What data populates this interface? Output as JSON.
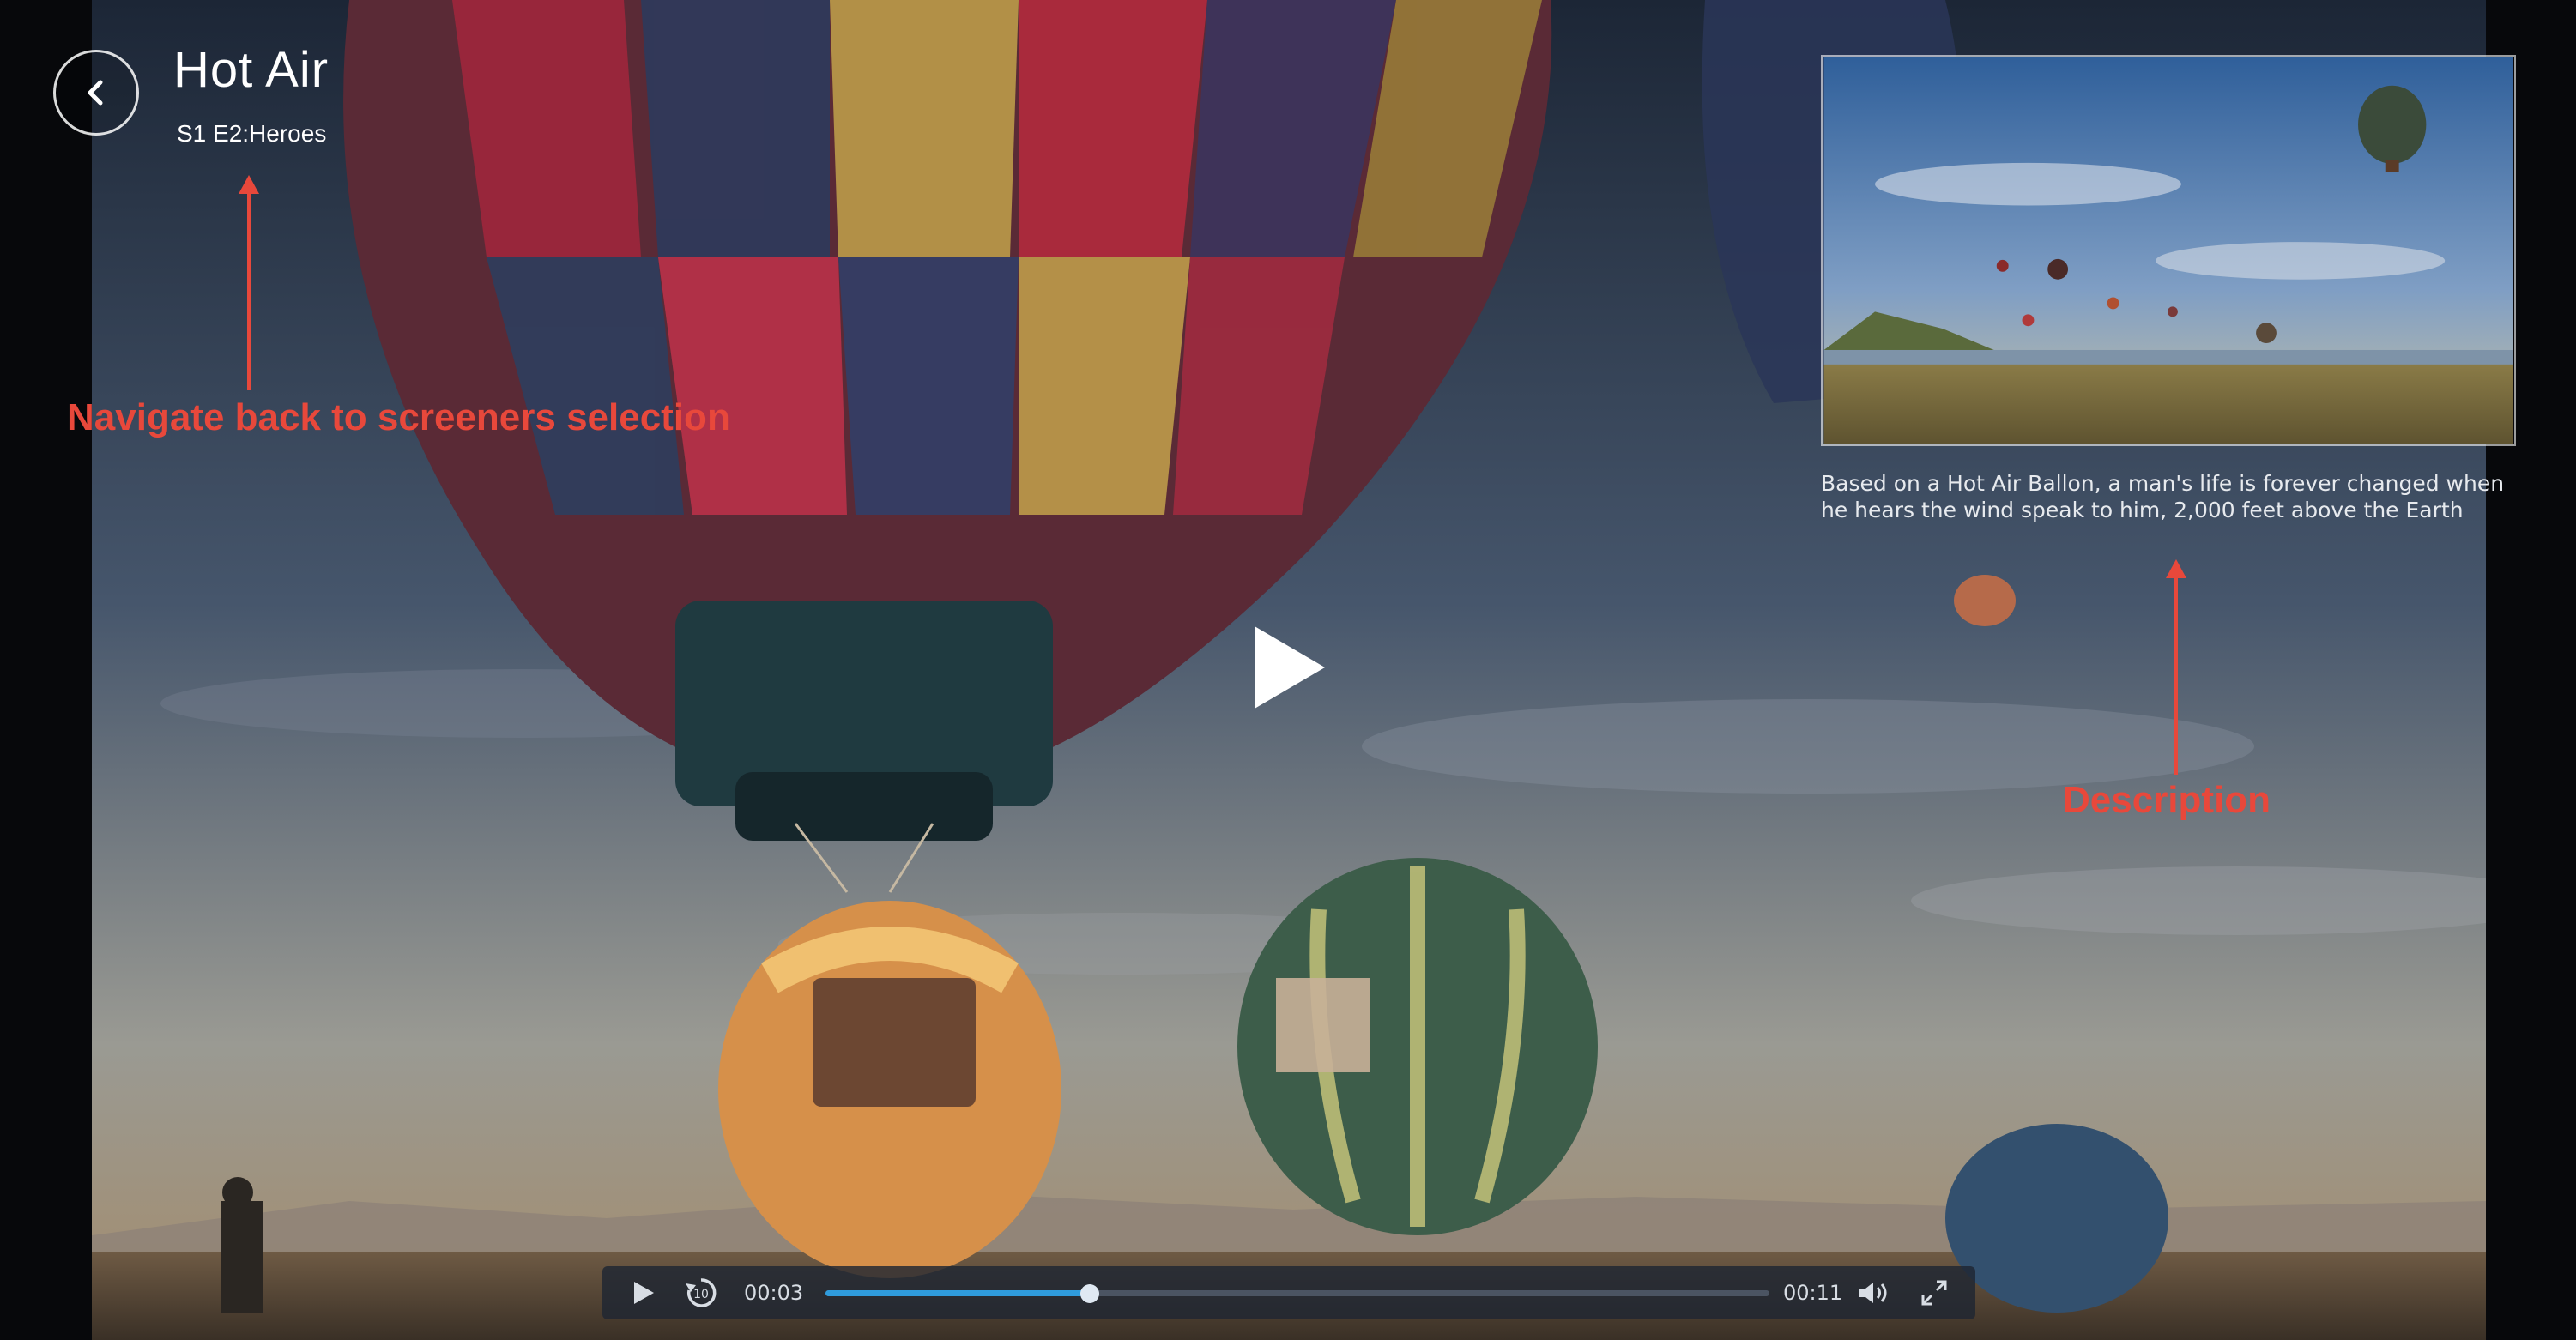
{
  "header": {
    "title": "Hot Air",
    "subtitle": "S1 E2:Heroes"
  },
  "annotations": {
    "back_note": "Navigate back to screeners selection",
    "description_note": "Description"
  },
  "preview": {
    "description": "Based on a Hot Air Ballon, a man's life is forever changed when he hears the wind speak to him, 2,000 feet above the Earth"
  },
  "player": {
    "current_time": "00:03",
    "duration": "00:11",
    "progress": 0.28,
    "skip_back_seconds": "10",
    "accent_color": "#2f9bdc"
  },
  "icons": {
    "back": "chevron-left-icon",
    "big_play": "play-icon",
    "play": "play-icon",
    "replay": "replay-10-icon",
    "volume": "volume-icon",
    "fullscreen": "fullscreen-icon"
  }
}
